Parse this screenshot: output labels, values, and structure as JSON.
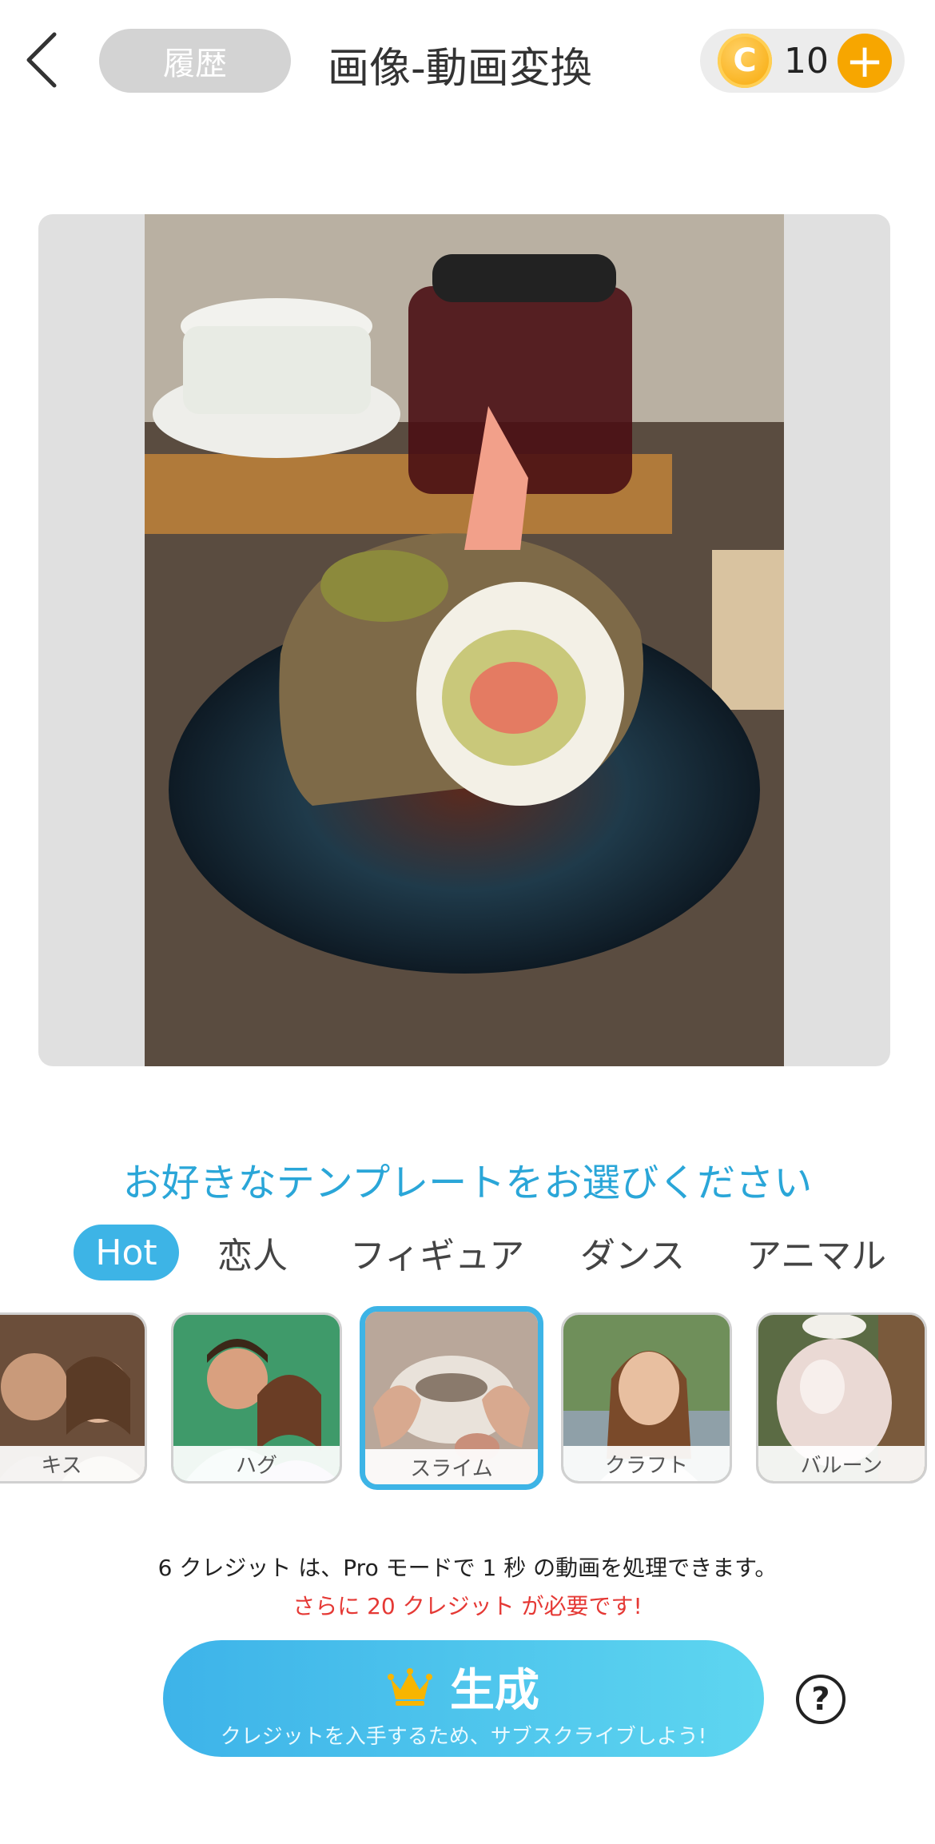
{
  "header": {
    "back_icon": "chevron-left-icon",
    "history_label": "履歴",
    "title": "画像-動画変換",
    "coin_symbol": "C",
    "credit_count": "10",
    "add_symbol": "+"
  },
  "image_panel": {
    "change_image_icon": "image-icon"
  },
  "prompt": "お好きなテンプレートをお選びください",
  "tabs": [
    {
      "label": "Hot",
      "active": true
    },
    {
      "label": "恋人"
    },
    {
      "label": "フィギュア"
    },
    {
      "label": "ダンス"
    },
    {
      "label": "アニマル"
    }
  ],
  "templates": [
    {
      "label": "キス"
    },
    {
      "label": "ハグ"
    },
    {
      "label": "スライム",
      "selected": true
    },
    {
      "label": "クラフト"
    },
    {
      "label": "バルーン"
    }
  ],
  "info": {
    "line1": "6 クレジット は、Pro モードで 1 秒 の動画を処理できます。",
    "line2": "さらに 20 クレジット が必要です!"
  },
  "generate": {
    "icon": "crown-icon",
    "label": "生成",
    "sublabel": "クレジットを入手するため、サブスクライブしよう!"
  },
  "help_symbol": "?",
  "colors": {
    "accent": "#3db4e6",
    "warning": "#e53935",
    "coin": "#f7a600"
  }
}
